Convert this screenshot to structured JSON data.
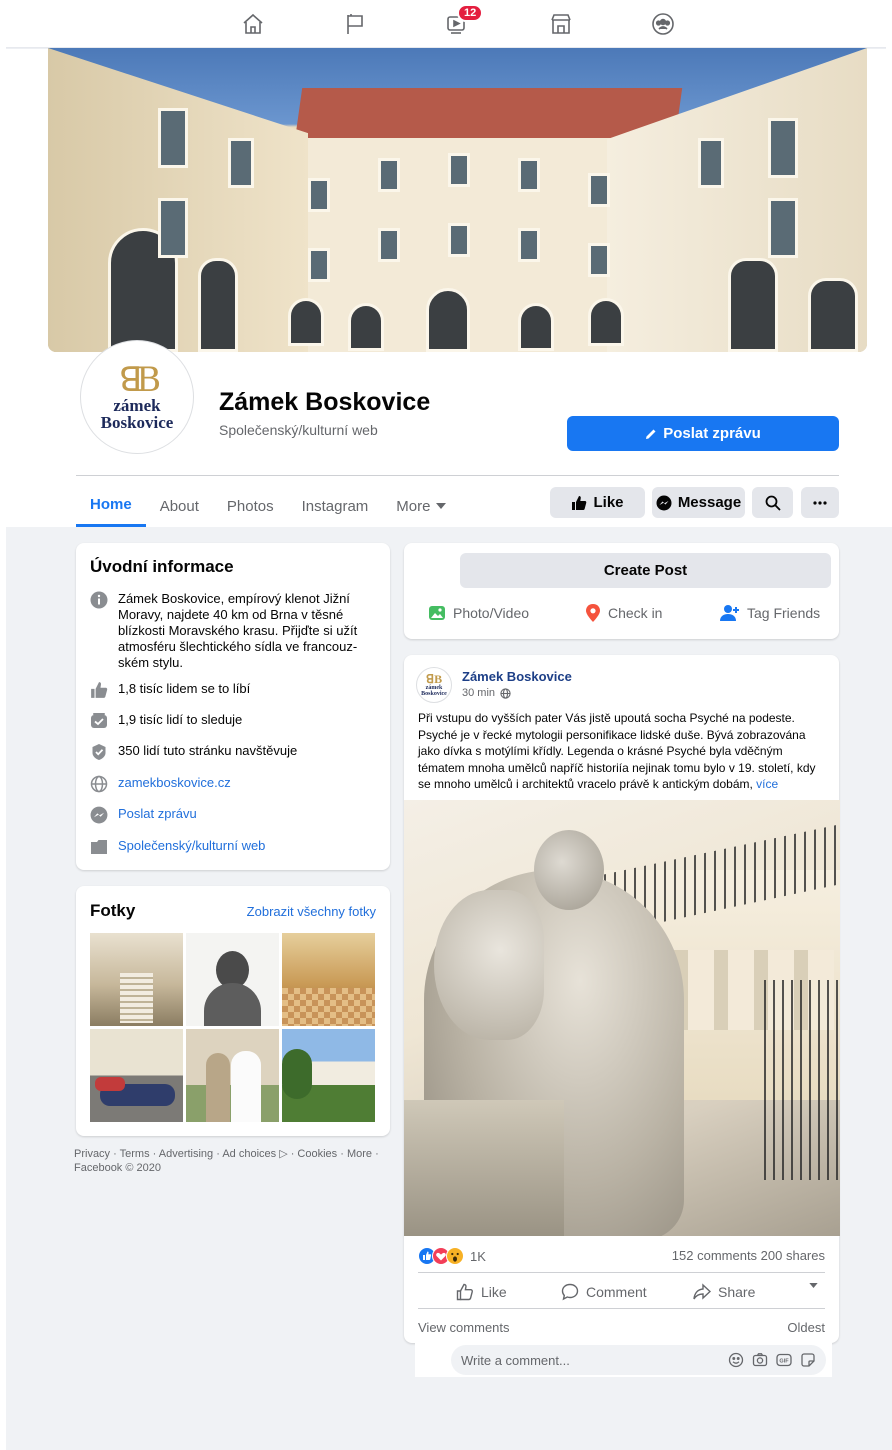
{
  "topnav": {
    "video_badge": "12"
  },
  "page": {
    "title": "Zámek Boskovice",
    "category": "Společenský/kulturní web",
    "avatar_mono": "ꓭB",
    "avatar_line1": "zámek",
    "avatar_line2": "Boskovice",
    "send_button": "Poslat zprávu"
  },
  "tabs": [
    {
      "label": "Home"
    },
    {
      "label": "About"
    },
    {
      "label": "Photos"
    },
    {
      "label": "Instagram"
    },
    {
      "label": "More"
    }
  ],
  "actions": {
    "like": "Like",
    "message": "Message"
  },
  "intro": {
    "title": "Úvodní informace",
    "description": "Zámek Boskovice, empírový klenot Jižní Moravy, najdete 40 km od Brna v těsné blízkosti Moravského krasu. Přijďte si užít atmosféru šlechtického sídla ve francouz-ském stylu.",
    "likes": "1,8 tisíc lidem se to líbí",
    "follows": "1,9 tisíc lidí to sleduje",
    "visits": "350 lidí tuto stránku navštěvuje",
    "website": "zamekboskovice.cz",
    "send_message": "Poslat zprávu",
    "category": "Společenský/kulturní web"
  },
  "photos": {
    "title": "Fotky",
    "see_all": "Zobrazit všechny fotky"
  },
  "footer": {
    "text": "Privacy · Terms · Advertising · Ad choices ▷ · Cookies · More · Facebook © 2020"
  },
  "create_post": {
    "button": "Create Post",
    "photo_video": "Photo/Video",
    "check_in": "Check in",
    "tag_friends": "Tag Friends"
  },
  "post": {
    "author": "Zámek Boskovice",
    "time": "30 min",
    "text": "Při vstupu do vyšších pater Vás jistě upoutá socha Psyché na podeste. Psyché je v řecké mytologii personifikace lidské duše. Bývá zobrazována jako dívka s motýlími křídly. Legenda o krásné Psyché byla vděčným tématem mnoha umělců napříč historiía nejinak tomu bylo v 19. století, kdy se mnoho umělců i architektů vracelo právě k antickým dobám,",
    "more": "více",
    "reactions_count": "1K",
    "comments_shares": "152 comments  200 shares",
    "like": "Like",
    "comment": "Comment",
    "share": "Share",
    "view_comments": "View comments",
    "sort": "Oldest",
    "comment_placeholder": "Write a comment..."
  },
  "colors": {
    "accent": "#1877f2",
    "background": "#f0f2f5",
    "badge": "#e41e3f",
    "brand_gold": "#c19a4b",
    "brand_navy": "#1d2a5b"
  }
}
